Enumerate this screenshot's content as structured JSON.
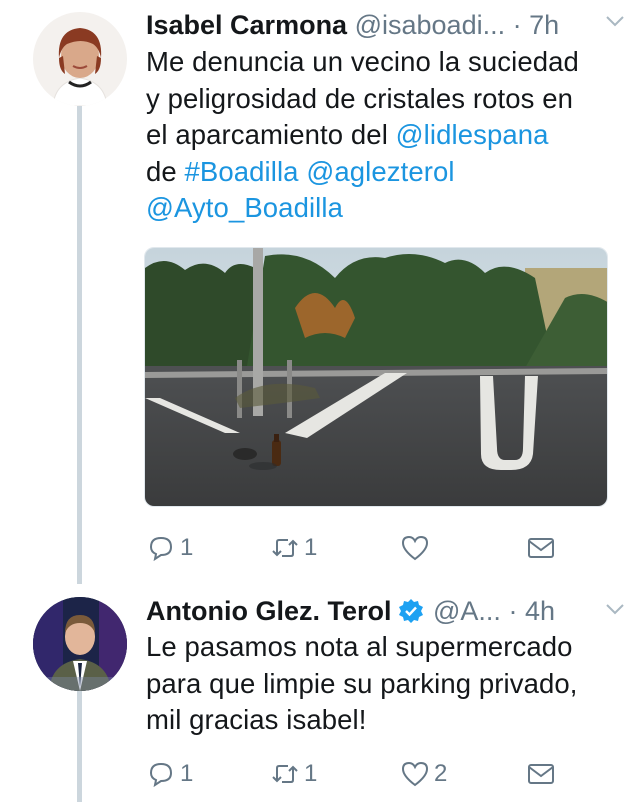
{
  "tweets": [
    {
      "author_name": "Isabel Carmona",
      "handle": "@isaboadi...",
      "time": "· 7h",
      "text_lines": [
        [
          {
            "t": "Me denuncia un vecino la suciedad"
          }
        ],
        [
          {
            "t": "y peligrosidad de cristales rotos en"
          }
        ],
        [
          {
            "t": "el aparcamiento del "
          },
          {
            "t": "@lidlespana",
            "link": true
          }
        ],
        [
          {
            "t": "de "
          },
          {
            "t": "#Boadilla",
            "link": true
          },
          {
            "t": " "
          },
          {
            "t": "@aglezterol",
            "link": true
          }
        ],
        [
          {
            "t": "@Ayto_Boadilla",
            "link": true
          }
        ]
      ],
      "reply_count": "1",
      "retweet_count": "1",
      "like_count": ""
    },
    {
      "author_name": "Antonio Glez. Terol",
      "verified": true,
      "handle": "@A...",
      "time": "· 4h",
      "text_lines": [
        [
          {
            "t": "Le pasamos nota al supermercado"
          }
        ],
        [
          {
            "t": "para que limpie su parking privado,"
          }
        ],
        [
          {
            "t": "mil gracias isabel!"
          }
        ]
      ],
      "reply_count": "1",
      "retweet_count": "1",
      "like_count": "2"
    }
  ],
  "icons": {
    "reply": "reply-icon",
    "retweet": "retweet-icon",
    "like": "heart-icon",
    "dm": "envelope-icon",
    "caret": "chevron-down-icon",
    "verified": "verified-badge-icon"
  },
  "colors": {
    "link": "#1b95e0",
    "secondary_text": "#657786",
    "thread_line": "#ccd6dd",
    "verified": "#1da1f2"
  }
}
